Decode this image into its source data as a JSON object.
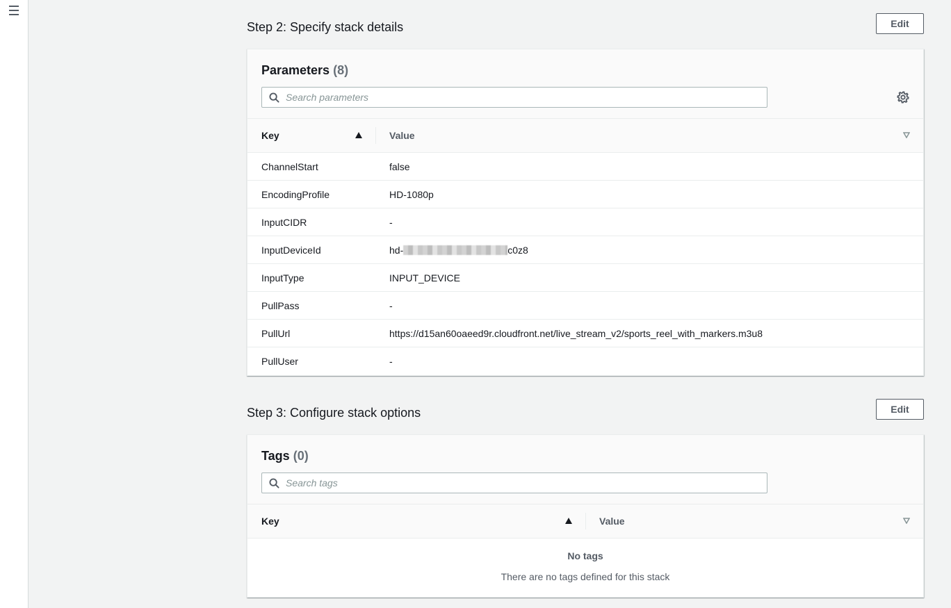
{
  "sidebar": {
    "menu_icon": "hamburger-menu-icon"
  },
  "step2": {
    "title": "Step 2: Specify stack details",
    "edit_label": "Edit",
    "panel": {
      "title": "Parameters",
      "count": "(8)",
      "search_placeholder": "Search parameters",
      "columns": {
        "key": "Key",
        "value": "Value"
      },
      "rows": [
        {
          "key": "ChannelStart",
          "value": "false"
        },
        {
          "key": "EncodingProfile",
          "value": "HD-1080p"
        },
        {
          "key": "InputCIDR",
          "value": "-"
        },
        {
          "key": "InputDeviceId",
          "value_prefix": "hd-",
          "value_suffix": "c0z8"
        },
        {
          "key": "InputType",
          "value": "INPUT_DEVICE"
        },
        {
          "key": "PullPass",
          "value": "-"
        },
        {
          "key": "PullUrl",
          "value": "https://d15an60oaeed9r.cloudfront.net/live_stream_v2/sports_reel_with_markers.m3u8"
        },
        {
          "key": "PullUser",
          "value": "-"
        }
      ]
    }
  },
  "step3": {
    "title": "Step 3: Configure stack options",
    "edit_label": "Edit",
    "panel": {
      "title": "Tags",
      "count": "(0)",
      "search_placeholder": "Search tags",
      "columns": {
        "key": "Key",
        "value": "Value"
      },
      "empty_title": "No tags",
      "empty_desc": "There are no tags defined for this stack"
    }
  },
  "colors": {
    "background": "#f2f3f3",
    "border": "#eaeded",
    "text": "#16191f",
    "muted": "#545b64"
  }
}
